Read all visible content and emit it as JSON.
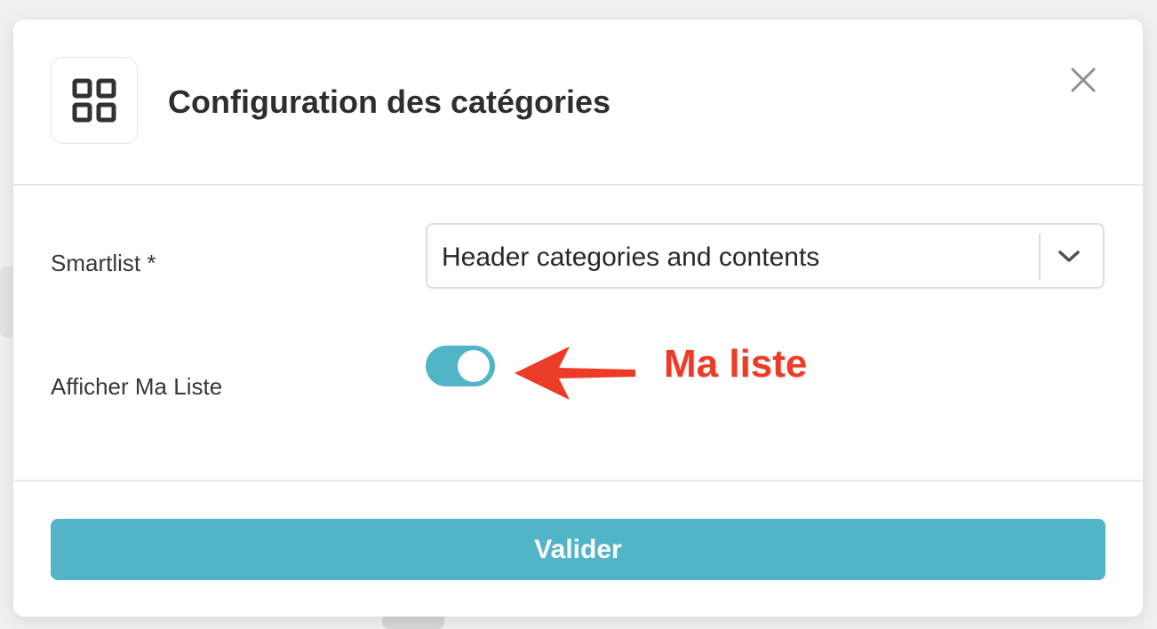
{
  "modal": {
    "title": "Configuration des catégories",
    "header_icon": "grid-icon",
    "close_icon": "close-icon"
  },
  "form": {
    "smartlist_label": "Smartlist *",
    "smartlist_value": "Header categories and contents",
    "smartlist_icon": "chevron-down-icon",
    "mylist_label": "Afficher Ma Liste",
    "mylist_enabled": true
  },
  "annotation": {
    "text": "Ma liste",
    "color": "#ec3b26"
  },
  "footer": {
    "submit_label": "Valider"
  },
  "colors": {
    "accent": "#52b5c7",
    "title": "#2b2f33",
    "annotation": "#ec3b26"
  }
}
